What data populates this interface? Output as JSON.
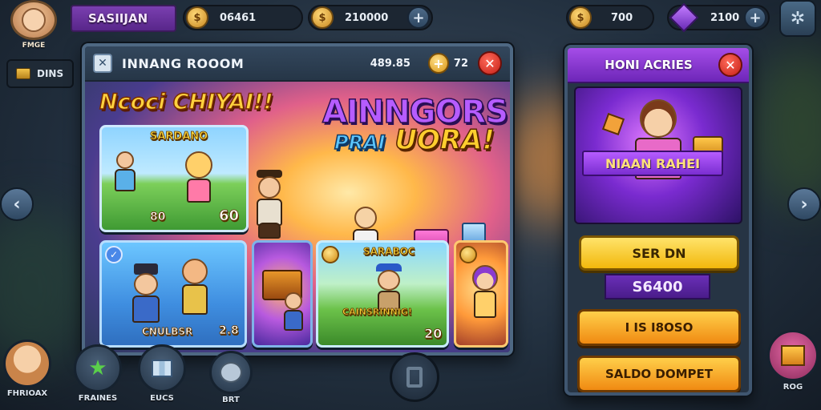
{
  "player": {
    "avatar_label": "FMGE",
    "name": "SASIIJAN"
  },
  "resources_left": [
    {
      "icon": "coin-icon",
      "value": "06461"
    },
    {
      "icon": "coin-icon",
      "value": "210000"
    }
  ],
  "resources_right": [
    {
      "icon": "coin-icon",
      "value": "700"
    },
    {
      "icon": "gem-icon",
      "value": "2100"
    }
  ],
  "side_button": {
    "label": "DINS"
  },
  "main_panel": {
    "title": "INNANG ROOOM",
    "score": "489.85",
    "count": "72",
    "banner_title": "Ncoci CHIYAI!!",
    "headline_line1": "AINNGORS",
    "headline_line2_a": "PRAI",
    "headline_line2_b": "UORA!",
    "cards": {
      "feature": {
        "title": "SARDANO",
        "left_value": "80",
        "right_value": "60"
      },
      "blue": {
        "label": "CNULBSR",
        "value": "2.8"
      },
      "green": {
        "title": "SARABOC",
        "label": "CAINSRINNIG!",
        "value": "20"
      }
    }
  },
  "right_panel": {
    "title": "HONI ACRIES",
    "ribbon": "NIAAN RAHEI",
    "primary_button": "SER DN",
    "price": "S6400",
    "button_2": "I IS I8OSO",
    "button_3": "SALDO DOMPET"
  },
  "bottom_nav": [
    {
      "label": "FHRIOAX",
      "icon": "avatar-icon"
    },
    {
      "label": "FRAINES",
      "icon": "star-icon"
    },
    {
      "label": "EUCS",
      "icon": "map-icon"
    },
    {
      "label": "BRT",
      "icon": "bear-icon"
    }
  ],
  "bottom_right": {
    "label": "ROG"
  },
  "colors": {
    "panel_border": "#4e6883",
    "purple_header": "#a54de8",
    "gold_button": "#f2b80c",
    "orange_button": "#f08a12",
    "close_red": "#c41f16"
  }
}
